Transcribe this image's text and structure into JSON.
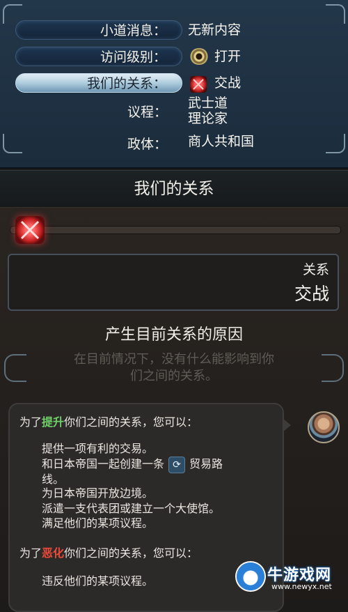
{
  "info_panel": {
    "rows": [
      {
        "label": "小道消息：",
        "value": "无新内容"
      },
      {
        "label": "访问级别：",
        "value": "打开",
        "icon": "eye-icon"
      },
      {
        "label": "我们的关系：",
        "value": "交战",
        "icon": "war-icon"
      }
    ],
    "agenda_label": "议程：",
    "agenda_values": [
      "武士道",
      "理论家"
    ],
    "government_label": "政体：",
    "government_value": "商人共和国"
  },
  "relation": {
    "header_title": "我们的关系",
    "status_label": "关系",
    "status_value": "交战",
    "reason_title": "产生目前关系的原因",
    "reason_text_lines": [
      "在目前情况下，没有什么能影响到你",
      "们之间的关系。"
    ]
  },
  "advice": {
    "improve_prefix": "为了",
    "improve_keyword": "提升",
    "improve_suffix": "你们之间的关系，您可以：",
    "improve_items": [
      "提供一项有利的交易。",
      "和日本帝国一起创建一条",
      "贸易路",
      "线。",
      "为日本帝国开放边境。",
      "派遣一支代表团或建立一个大使馆。",
      "满足他们的某项议程。"
    ],
    "worsen_prefix": "为了",
    "worsen_keyword": "恶化",
    "worsen_suffix": "你们之间的关系，您可以：",
    "worsen_items": [
      "违反他们的某项议程。"
    ],
    "trade_icon": "trade-route-icon"
  },
  "watermark": {
    "name": "牛游戏网",
    "url": "www.newyx.net"
  },
  "colors": {
    "improve": "#6fd06a",
    "worsen": "#ee4a3a",
    "panel_blue": "#1b2c3c"
  }
}
